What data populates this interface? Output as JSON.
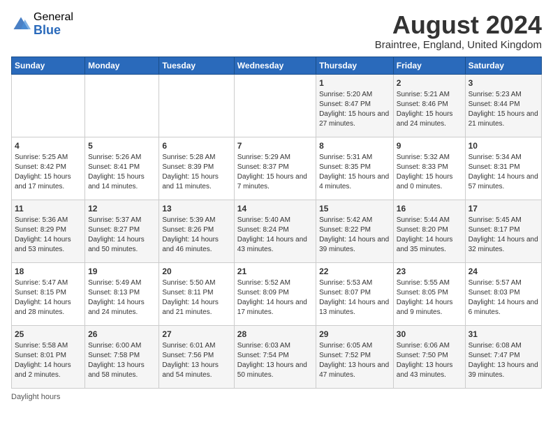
{
  "header": {
    "logo_general": "General",
    "logo_blue": "Blue",
    "month_year": "August 2024",
    "location": "Braintree, England, United Kingdom"
  },
  "days_of_week": [
    "Sunday",
    "Monday",
    "Tuesday",
    "Wednesday",
    "Thursday",
    "Friday",
    "Saturday"
  ],
  "weeks": [
    [
      {
        "day": "",
        "info": ""
      },
      {
        "day": "",
        "info": ""
      },
      {
        "day": "",
        "info": ""
      },
      {
        "day": "",
        "info": ""
      },
      {
        "day": "1",
        "info": "Sunrise: 5:20 AM\nSunset: 8:47 PM\nDaylight: 15 hours and 27 minutes."
      },
      {
        "day": "2",
        "info": "Sunrise: 5:21 AM\nSunset: 8:46 PM\nDaylight: 15 hours and 24 minutes."
      },
      {
        "day": "3",
        "info": "Sunrise: 5:23 AM\nSunset: 8:44 PM\nDaylight: 15 hours and 21 minutes."
      }
    ],
    [
      {
        "day": "4",
        "info": "Sunrise: 5:25 AM\nSunset: 8:42 PM\nDaylight: 15 hours and 17 minutes."
      },
      {
        "day": "5",
        "info": "Sunrise: 5:26 AM\nSunset: 8:41 PM\nDaylight: 15 hours and 14 minutes."
      },
      {
        "day": "6",
        "info": "Sunrise: 5:28 AM\nSunset: 8:39 PM\nDaylight: 15 hours and 11 minutes."
      },
      {
        "day": "7",
        "info": "Sunrise: 5:29 AM\nSunset: 8:37 PM\nDaylight: 15 hours and 7 minutes."
      },
      {
        "day": "8",
        "info": "Sunrise: 5:31 AM\nSunset: 8:35 PM\nDaylight: 15 hours and 4 minutes."
      },
      {
        "day": "9",
        "info": "Sunrise: 5:32 AM\nSunset: 8:33 PM\nDaylight: 15 hours and 0 minutes."
      },
      {
        "day": "10",
        "info": "Sunrise: 5:34 AM\nSunset: 8:31 PM\nDaylight: 14 hours and 57 minutes."
      }
    ],
    [
      {
        "day": "11",
        "info": "Sunrise: 5:36 AM\nSunset: 8:29 PM\nDaylight: 14 hours and 53 minutes."
      },
      {
        "day": "12",
        "info": "Sunrise: 5:37 AM\nSunset: 8:27 PM\nDaylight: 14 hours and 50 minutes."
      },
      {
        "day": "13",
        "info": "Sunrise: 5:39 AM\nSunset: 8:26 PM\nDaylight: 14 hours and 46 minutes."
      },
      {
        "day": "14",
        "info": "Sunrise: 5:40 AM\nSunset: 8:24 PM\nDaylight: 14 hours and 43 minutes."
      },
      {
        "day": "15",
        "info": "Sunrise: 5:42 AM\nSunset: 8:22 PM\nDaylight: 14 hours and 39 minutes."
      },
      {
        "day": "16",
        "info": "Sunrise: 5:44 AM\nSunset: 8:20 PM\nDaylight: 14 hours and 35 minutes."
      },
      {
        "day": "17",
        "info": "Sunrise: 5:45 AM\nSunset: 8:17 PM\nDaylight: 14 hours and 32 minutes."
      }
    ],
    [
      {
        "day": "18",
        "info": "Sunrise: 5:47 AM\nSunset: 8:15 PM\nDaylight: 14 hours and 28 minutes."
      },
      {
        "day": "19",
        "info": "Sunrise: 5:49 AM\nSunset: 8:13 PM\nDaylight: 14 hours and 24 minutes."
      },
      {
        "day": "20",
        "info": "Sunrise: 5:50 AM\nSunset: 8:11 PM\nDaylight: 14 hours and 21 minutes."
      },
      {
        "day": "21",
        "info": "Sunrise: 5:52 AM\nSunset: 8:09 PM\nDaylight: 14 hours and 17 minutes."
      },
      {
        "day": "22",
        "info": "Sunrise: 5:53 AM\nSunset: 8:07 PM\nDaylight: 14 hours and 13 minutes."
      },
      {
        "day": "23",
        "info": "Sunrise: 5:55 AM\nSunset: 8:05 PM\nDaylight: 14 hours and 9 minutes."
      },
      {
        "day": "24",
        "info": "Sunrise: 5:57 AM\nSunset: 8:03 PM\nDaylight: 14 hours and 6 minutes."
      }
    ],
    [
      {
        "day": "25",
        "info": "Sunrise: 5:58 AM\nSunset: 8:01 PM\nDaylight: 14 hours and 2 minutes."
      },
      {
        "day": "26",
        "info": "Sunrise: 6:00 AM\nSunset: 7:58 PM\nDaylight: 13 hours and 58 minutes."
      },
      {
        "day": "27",
        "info": "Sunrise: 6:01 AM\nSunset: 7:56 PM\nDaylight: 13 hours and 54 minutes."
      },
      {
        "day": "28",
        "info": "Sunrise: 6:03 AM\nSunset: 7:54 PM\nDaylight: 13 hours and 50 minutes."
      },
      {
        "day": "29",
        "info": "Sunrise: 6:05 AM\nSunset: 7:52 PM\nDaylight: 13 hours and 47 minutes."
      },
      {
        "day": "30",
        "info": "Sunrise: 6:06 AM\nSunset: 7:50 PM\nDaylight: 13 hours and 43 minutes."
      },
      {
        "day": "31",
        "info": "Sunrise: 6:08 AM\nSunset: 7:47 PM\nDaylight: 13 hours and 39 minutes."
      }
    ]
  ],
  "footer": "Daylight hours"
}
